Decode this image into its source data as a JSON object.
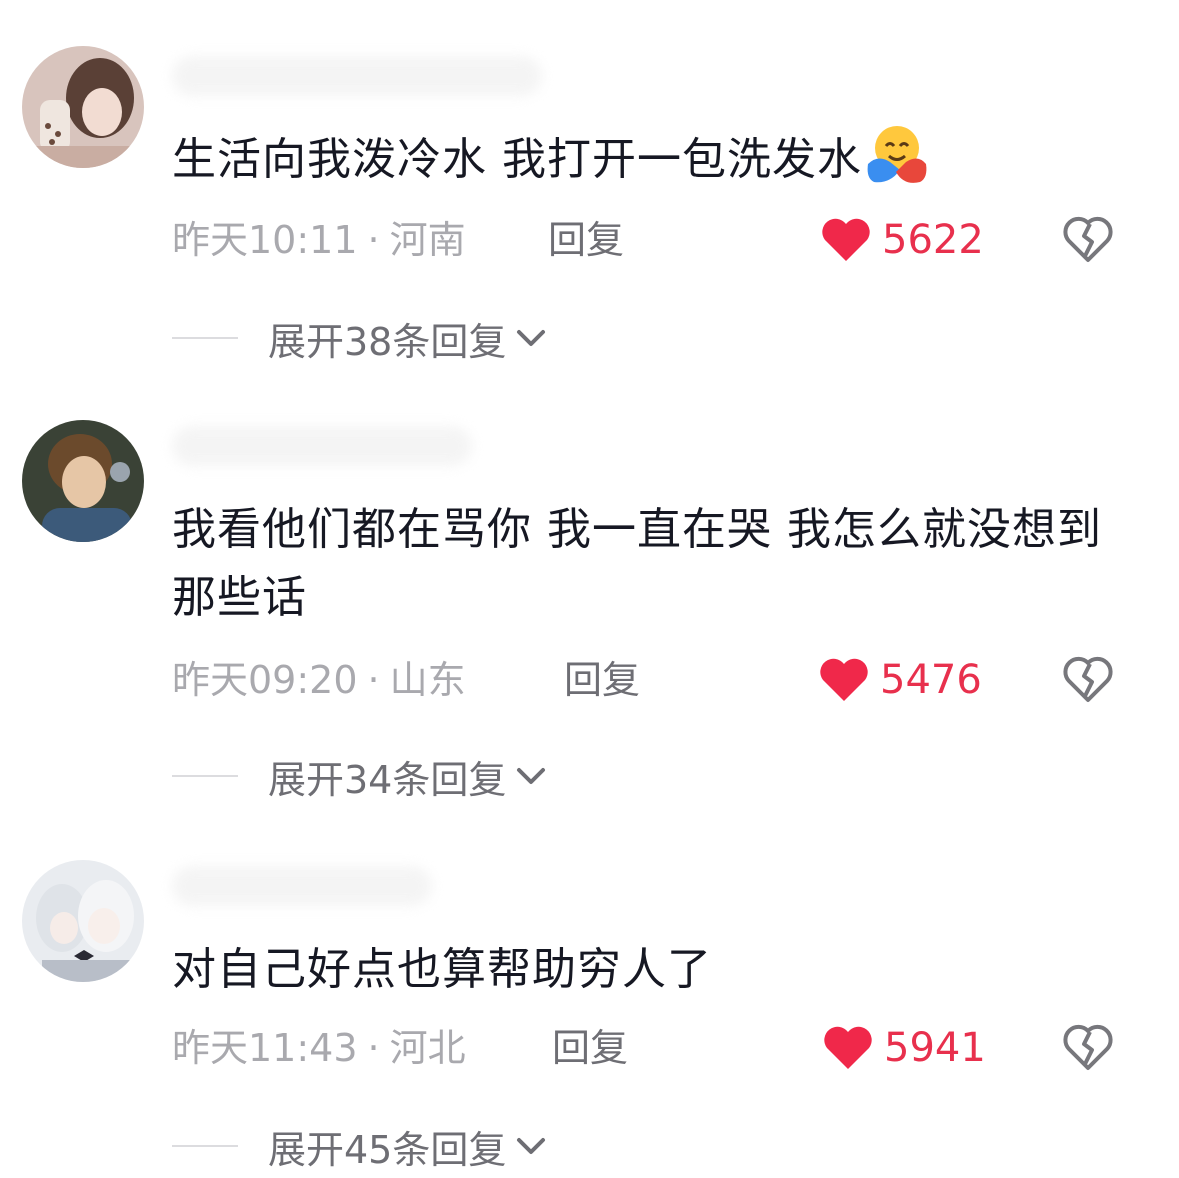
{
  "colors": {
    "text": "#161823",
    "meta": "#a9a9ae",
    "action": "#6e6e74",
    "like_red": "#e8304d"
  },
  "comments": [
    {
      "text": "生活向我泼冷水 我打开一包洗发水",
      "emoji": "hugging-face-emoji",
      "time": "昨天10:11",
      "dot": "·",
      "location": "河南",
      "reply_label": "回复",
      "likes": "5622",
      "expand_label": "展开38条回复"
    },
    {
      "text": "我看他们都在骂你 我一直在哭 我怎么就没想到那些话",
      "time": "昨天09:20",
      "dot": "·",
      "location": "山东",
      "reply_label": "回复",
      "likes": "5476",
      "expand_label": "展开34条回复"
    },
    {
      "text": "对自己好点也算帮助穷人了",
      "time": "昨天11:43",
      "dot": "·",
      "location": "河北",
      "reply_label": "回复",
      "likes": "5941",
      "expand_label": "展开45条回复"
    }
  ]
}
